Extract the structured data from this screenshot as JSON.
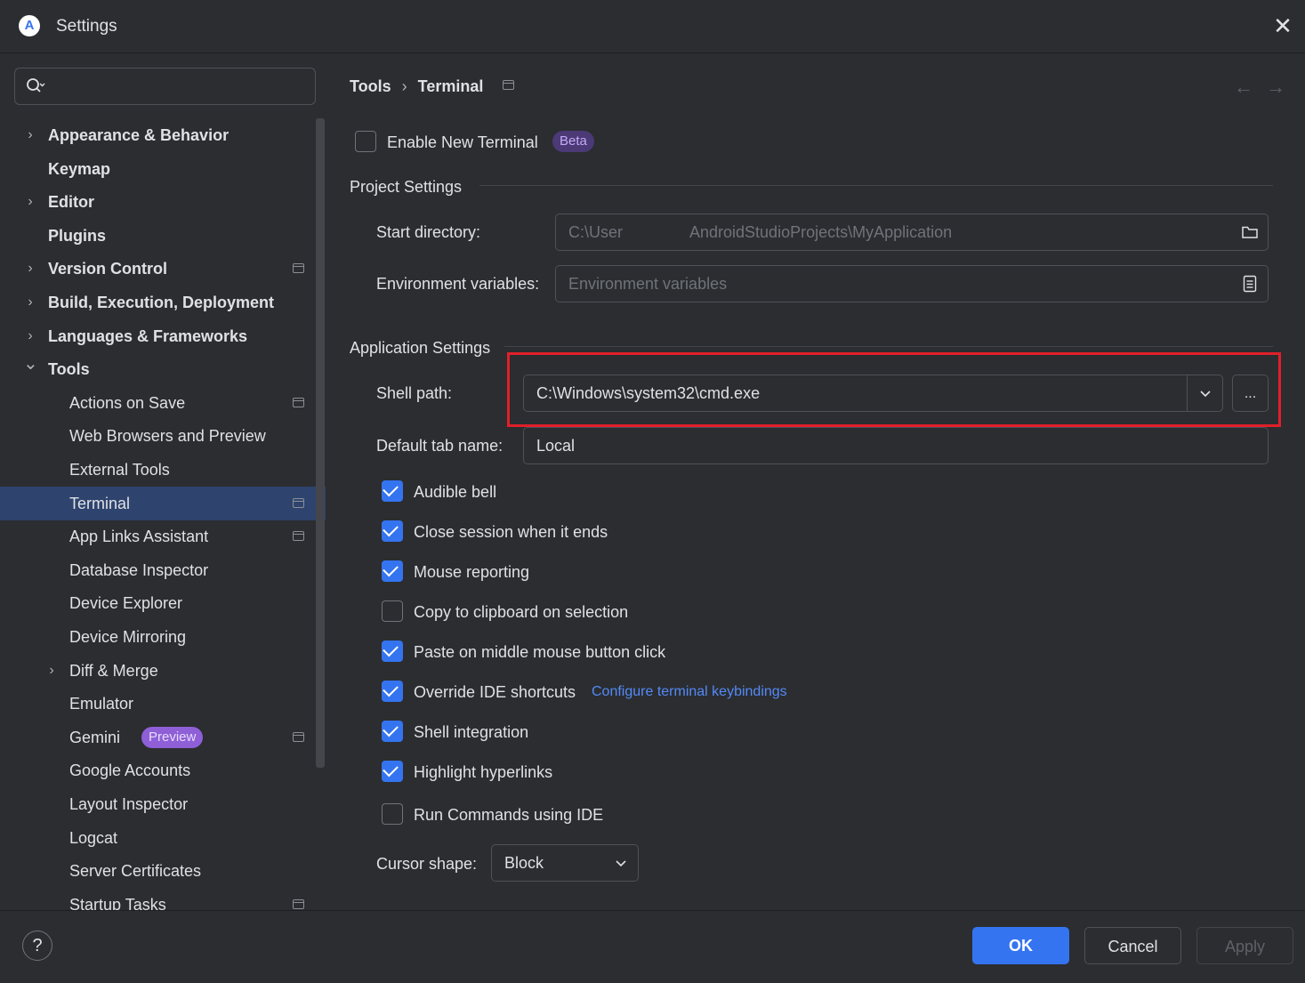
{
  "window": {
    "title": "Settings",
    "app_icon": "android-studio-icon",
    "close_icon": "close-icon"
  },
  "search": {
    "value": "",
    "placeholder": ""
  },
  "sidebar": {
    "items": [
      {
        "label": "Appearance & Behavior",
        "bold": true,
        "level": 0,
        "expandable": true,
        "expanded": false,
        "pinned": false,
        "selected": false
      },
      {
        "label": "Keymap",
        "bold": true,
        "level": 0,
        "expandable": false,
        "pinned": false,
        "selected": false
      },
      {
        "label": "Editor",
        "bold": true,
        "level": 0,
        "expandable": true,
        "expanded": false,
        "pinned": false,
        "selected": false
      },
      {
        "label": "Plugins",
        "bold": true,
        "level": 0,
        "expandable": false,
        "pinned": false,
        "selected": false
      },
      {
        "label": "Version Control",
        "bold": true,
        "level": 0,
        "expandable": true,
        "expanded": false,
        "pinned": true,
        "selected": false
      },
      {
        "label": "Build, Execution, Deployment",
        "bold": true,
        "level": 0,
        "expandable": true,
        "expanded": false,
        "pinned": false,
        "selected": false
      },
      {
        "label": "Languages & Frameworks",
        "bold": true,
        "level": 0,
        "expandable": true,
        "expanded": false,
        "pinned": false,
        "selected": false
      },
      {
        "label": "Tools",
        "bold": true,
        "level": 0,
        "expandable": true,
        "expanded": true,
        "pinned": false,
        "selected": false
      },
      {
        "label": "Actions on Save",
        "bold": false,
        "level": 1,
        "expandable": false,
        "pinned": true,
        "selected": false
      },
      {
        "label": "Web Browsers and Preview",
        "bold": false,
        "level": 1,
        "expandable": false,
        "pinned": false,
        "selected": false
      },
      {
        "label": "External Tools",
        "bold": false,
        "level": 1,
        "expandable": false,
        "pinned": false,
        "selected": false
      },
      {
        "label": "Terminal",
        "bold": false,
        "level": 1,
        "expandable": false,
        "pinned": true,
        "selected": true
      },
      {
        "label": "App Links Assistant",
        "bold": false,
        "level": 1,
        "expandable": false,
        "pinned": true,
        "selected": false
      },
      {
        "label": "Database Inspector",
        "bold": false,
        "level": 1,
        "expandable": false,
        "pinned": false,
        "selected": false
      },
      {
        "label": "Device Explorer",
        "bold": false,
        "level": 1,
        "expandable": false,
        "pinned": false,
        "selected": false
      },
      {
        "label": "Device Mirroring",
        "bold": false,
        "level": 1,
        "expandable": false,
        "pinned": false,
        "selected": false
      },
      {
        "label": "Diff & Merge",
        "bold": false,
        "level": 1,
        "expandable": true,
        "expanded": false,
        "pinned": false,
        "selected": false
      },
      {
        "label": "Emulator",
        "bold": false,
        "level": 1,
        "expandable": false,
        "pinned": false,
        "selected": false
      },
      {
        "label": "Gemini",
        "bold": false,
        "level": 1,
        "expandable": false,
        "pinned": true,
        "selected": false,
        "badge": "Preview"
      },
      {
        "label": "Google Accounts",
        "bold": false,
        "level": 1,
        "expandable": false,
        "pinned": false,
        "selected": false
      },
      {
        "label": "Layout Inspector",
        "bold": false,
        "level": 1,
        "expandable": false,
        "pinned": false,
        "selected": false
      },
      {
        "label": "Logcat",
        "bold": false,
        "level": 1,
        "expandable": false,
        "pinned": false,
        "selected": false
      },
      {
        "label": "Server Certificates",
        "bold": false,
        "level": 1,
        "expandable": false,
        "pinned": false,
        "selected": false
      },
      {
        "label": "Startup Tasks",
        "bold": false,
        "level": 1,
        "expandable": false,
        "pinned": true,
        "selected": false
      }
    ]
  },
  "breadcrumb": {
    "parent": "Tools",
    "current": "Terminal"
  },
  "enable_new_terminal": {
    "label": "Enable New Terminal",
    "checked": false,
    "badge": "Beta"
  },
  "project_settings": {
    "title": "Project Settings",
    "start_directory": {
      "label": "Start directory:",
      "value_part1": "C:\\User",
      "value_part2": "AndroidStudioProjects\\MyApplication",
      "icon": "folder-icon"
    },
    "environment_variables": {
      "label": "Environment variables:",
      "placeholder": "Environment variables",
      "icon": "document-icon"
    }
  },
  "application_settings": {
    "title": "Application Settings",
    "shell_path": {
      "label": "Shell path:",
      "value": "C:\\Windows\\system32\\cmd.exe",
      "browse_label": "..."
    },
    "default_tab_name": {
      "label": "Default tab name:",
      "value": "Local"
    },
    "options": [
      {
        "label": "Audible bell",
        "checked": true
      },
      {
        "label": "Close session when it ends",
        "checked": true
      },
      {
        "label": "Mouse reporting",
        "checked": true
      },
      {
        "label": "Copy to clipboard on selection",
        "checked": false
      },
      {
        "label": "Paste on middle mouse button click",
        "checked": true
      },
      {
        "label": "Override IDE shortcuts",
        "checked": true,
        "link": "Configure terminal keybindings"
      },
      {
        "label": "Shell integration",
        "checked": true
      },
      {
        "label": "Highlight hyperlinks",
        "checked": true
      },
      {
        "label": "Run Commands using IDE",
        "checked": false
      }
    ],
    "cursor_shape": {
      "label": "Cursor shape:",
      "value": "Block"
    }
  },
  "footer": {
    "help": "?",
    "ok": "OK",
    "cancel": "Cancel",
    "apply": "Apply"
  },
  "colors": {
    "accent": "#3574f0",
    "highlight": "#e0202a",
    "selection": "#2e436e",
    "background": "#2b2d30",
    "link": "#548af7"
  }
}
